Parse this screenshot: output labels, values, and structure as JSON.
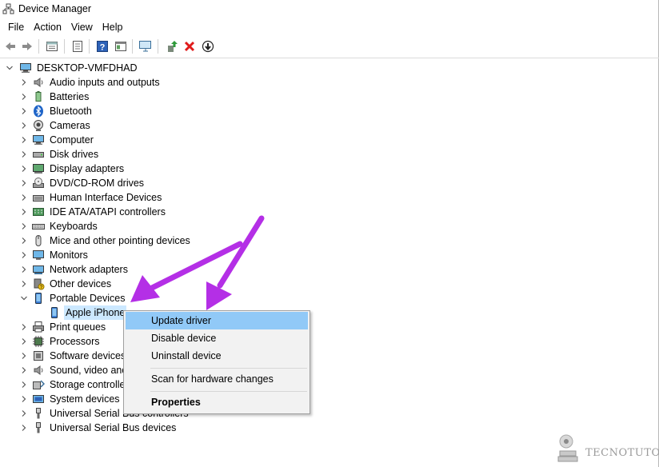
{
  "window": {
    "title": "Device Manager"
  },
  "menu": [
    "File",
    "Action",
    "View",
    "Help"
  ],
  "toolbar": [
    {
      "name": "back-icon"
    },
    {
      "name": "forward-icon"
    },
    {
      "name": "properties-view-icon"
    },
    {
      "name": "list-icon"
    },
    {
      "name": "help-icon"
    },
    {
      "name": "panel-icon"
    },
    {
      "name": "scan-hardware-icon"
    },
    {
      "name": "update-driver-icon"
    },
    {
      "name": "uninstall-icon"
    },
    {
      "name": "disable-device-icon"
    }
  ],
  "tree": {
    "root": "DESKTOP-VMFDHAD",
    "categories": [
      {
        "label": "Audio inputs and outputs",
        "icon": "speaker-icon",
        "expanded": false
      },
      {
        "label": "Batteries",
        "icon": "battery-icon",
        "expanded": false
      },
      {
        "label": "Bluetooth",
        "icon": "bluetooth-icon",
        "expanded": false
      },
      {
        "label": "Cameras",
        "icon": "camera-icon",
        "expanded": false
      },
      {
        "label": "Computer",
        "icon": "computer-icon",
        "expanded": false
      },
      {
        "label": "Disk drives",
        "icon": "disk-drive-icon",
        "expanded": false
      },
      {
        "label": "Display adapters",
        "icon": "display-adapter-icon",
        "expanded": false
      },
      {
        "label": "DVD/CD-ROM drives",
        "icon": "dvd-icon",
        "expanded": false
      },
      {
        "label": "Human Interface Devices",
        "icon": "hid-icon",
        "expanded": false
      },
      {
        "label": "IDE ATA/ATAPI controllers",
        "icon": "ide-icon",
        "expanded": false
      },
      {
        "label": "Keyboards",
        "icon": "keyboard-icon",
        "expanded": false
      },
      {
        "label": "Mice and other pointing devices",
        "icon": "mouse-icon",
        "expanded": false
      },
      {
        "label": "Monitors",
        "icon": "monitor-icon",
        "expanded": false
      },
      {
        "label": "Network adapters",
        "icon": "network-icon",
        "expanded": false
      },
      {
        "label": "Other devices",
        "icon": "other-devices-icon",
        "expanded": false
      },
      {
        "label": "Portable Devices",
        "icon": "portable-device-icon",
        "expanded": true
      },
      {
        "label": "Apple iPhone",
        "icon": "phone-icon",
        "child": true,
        "selected": true
      },
      {
        "label": "Print queues",
        "icon": "printer-icon",
        "expanded": false
      },
      {
        "label": "Processors",
        "icon": "processor-icon",
        "expanded": false
      },
      {
        "label": "Software devices",
        "icon": "software-device-icon",
        "expanded": false
      },
      {
        "label": "Sound, video and",
        "icon": "sound-icon",
        "expanded": false
      },
      {
        "label": "Storage controlle",
        "icon": "storage-icon",
        "expanded": false
      },
      {
        "label": "System devices",
        "icon": "system-icon",
        "expanded": false
      },
      {
        "label": "Universal Serial Bus controllers",
        "icon": "usb-icon",
        "expanded": false
      },
      {
        "label": "Universal Serial Bus devices",
        "icon": "usb-icon",
        "expanded": false
      }
    ]
  },
  "context_menu": {
    "items": [
      {
        "label": "Update driver",
        "highlighted": true
      },
      {
        "label": "Disable device"
      },
      {
        "label": "Uninstall device"
      },
      {
        "separator": true
      },
      {
        "label": "Scan for hardware changes"
      },
      {
        "separator": true
      },
      {
        "label": "Properties",
        "bold": true
      }
    ]
  },
  "annotation": {
    "arrow_color": "#b42fe6"
  },
  "watermark": {
    "text": "TECNOTUTO"
  }
}
